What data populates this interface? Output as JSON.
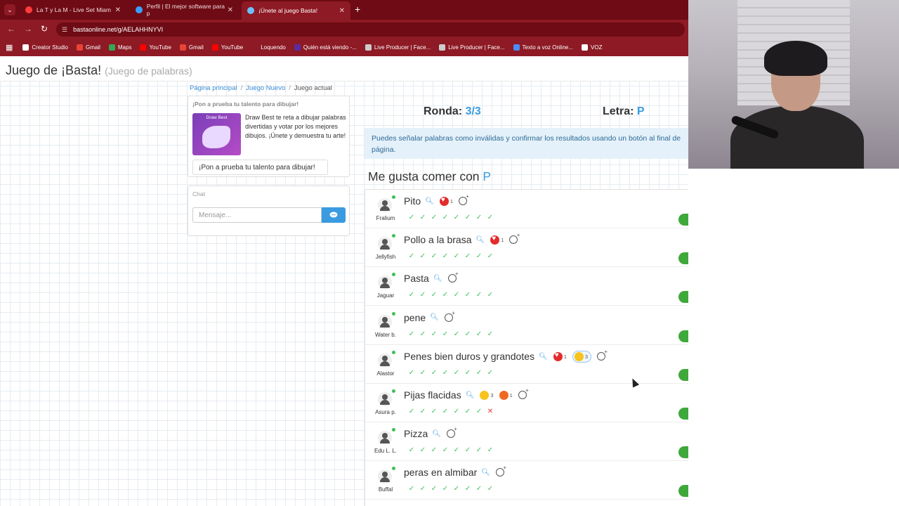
{
  "browser": {
    "tabs": [
      {
        "title": "La T y La M - Live Set Miam",
        "icon_color": "#ff3b3b",
        "active": false
      },
      {
        "title": "Perfil | El mejor software para p",
        "icon_color": "#3aa0ff",
        "active": false
      },
      {
        "title": "¡Únete al juego Basta!",
        "icon_color": "#6cc1ff",
        "active": true
      }
    ],
    "url": "bastaonline.net/g/AELAHHNYVI",
    "bookmarks": [
      {
        "label": "Creator Studio",
        "color": "#ffffff"
      },
      {
        "label": "Gmail",
        "color": "#ea4335"
      },
      {
        "label": "Maps",
        "color": "#34a853"
      },
      {
        "label": "YouTube",
        "color": "#ff0000"
      },
      {
        "label": "Gmail",
        "color": "#ea4335"
      },
      {
        "label": "YouTube",
        "color": "#ff0000"
      },
      {
        "label": "Loquendo",
        "color": "#8d1a24"
      },
      {
        "label": "Quién está viendo -...",
        "color": "#5b2ca0"
      },
      {
        "label": "Live Producer | Face...",
        "color": "#cccccc"
      },
      {
        "label": "Live Producer | Face...",
        "color": "#cccccc"
      },
      {
        "label": "Texto a voz Online...",
        "color": "#4a8df8"
      },
      {
        "label": "VOZ",
        "color": "#ffffff"
      }
    ]
  },
  "site": {
    "title": "Juego de ¡Basta!",
    "subtitle": "(Juego de palabras)"
  },
  "breadcrumb": [
    "Página principal",
    "Juego Nuevo",
    "Juego actual"
  ],
  "promo": {
    "title": "¡Pon a prueba tu talento para dibujar!",
    "image_label": "Draw Best",
    "text": "Draw Best te reta a dibujar palabras divertidas y votar por los mejores dibujos. ¡Únete y demuestra tu arte!",
    "button": "¡Pon a prueba tu talento para dibujar!"
  },
  "chat": {
    "title": "Chat",
    "placeholder": "Mensaje..."
  },
  "game": {
    "round_label": "Ronda:",
    "round_value": "3/3",
    "letter_label": "Letra:",
    "letter_value": "P",
    "info": "Puedes señalar palabras como inválidas y confirmar los resultados usando un botón al final de página.",
    "category": "Me gusta comer con",
    "category_letter": "P"
  },
  "answers": [
    {
      "word": "Pito",
      "player": "Fralium",
      "reactions": [
        {
          "type": "heart",
          "count": "1"
        }
      ],
      "checks": [
        "ok",
        "ok",
        "ok",
        "ok",
        "ok",
        "ok",
        "ok",
        "ok"
      ],
      "valid": true
    },
    {
      "word": "Pollo a la brasa",
      "player": "Jellyfish",
      "reactions": [
        {
          "type": "heart",
          "count": "1"
        }
      ],
      "checks": [
        "ok",
        "ok",
        "ok",
        "ok",
        "ok",
        "ok",
        "ok",
        "ok"
      ],
      "valid": true
    },
    {
      "word": "Pasta",
      "player": "Jaguar",
      "reactions": [],
      "checks": [
        "ok",
        "ok",
        "ok",
        "ok",
        "ok",
        "ok",
        "ok",
        "ok"
      ],
      "valid": true
    },
    {
      "word": "pene",
      "player": "Water b.",
      "reactions": [],
      "checks": [
        "ok",
        "ok",
        "ok",
        "ok",
        "ok",
        "ok",
        "ok",
        "ok"
      ],
      "valid": true
    },
    {
      "word": "Penes bien duros y grandotes",
      "player": "Alastor",
      "reactions": [
        {
          "type": "heart",
          "count": "1"
        },
        {
          "type": "laugh",
          "count": "3"
        }
      ],
      "checks": [
        "ok",
        "ok",
        "ok",
        "ok",
        "ok",
        "ok",
        "ok",
        "ok"
      ],
      "valid": true
    },
    {
      "word": "Pijas flacidas",
      "player": "Asura p.",
      "reactions": [
        {
          "type": "wow",
          "count": "3"
        },
        {
          "type": "angry",
          "count": "1"
        }
      ],
      "checks": [
        "ok",
        "ok",
        "ok",
        "ok",
        "ok",
        "ok",
        "ok",
        "bad"
      ],
      "valid": true
    },
    {
      "word": "Pizza",
      "player": "Edu L. L.",
      "reactions": [],
      "checks": [
        "ok",
        "ok",
        "ok",
        "ok",
        "ok",
        "ok",
        "ok",
        "ok"
      ],
      "valid": true
    },
    {
      "word": "peras en almibar",
      "player": "Buffal",
      "reactions": [],
      "checks": [
        "ok",
        "ok",
        "ok",
        "ok",
        "ok",
        "ok",
        "ok",
        "ok"
      ],
      "valid": true
    }
  ]
}
